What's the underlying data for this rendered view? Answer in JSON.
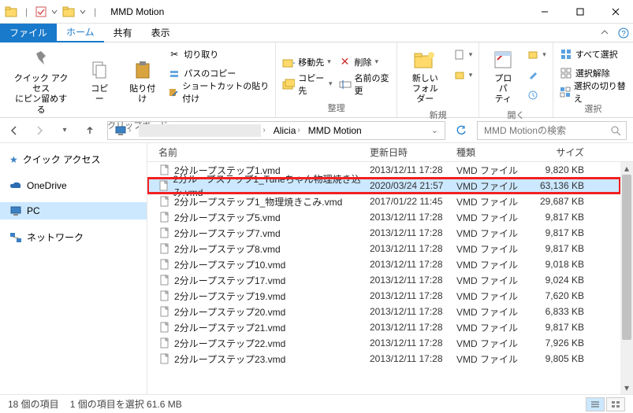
{
  "window": {
    "title": "MMD Motion"
  },
  "tabs": {
    "file": "ファイル",
    "home": "ホーム",
    "share": "共有",
    "view": "表示"
  },
  "ribbon": {
    "clipboard": {
      "label": "クリップボード",
      "quick_access": "クイック アクセス\nにピン留めする",
      "copy": "コピー",
      "paste": "貼り付け",
      "cut": "切り取り",
      "copy_path": "パスのコピー",
      "paste_shortcut": "ショートカットの貼り付け"
    },
    "organize": {
      "label": "整理",
      "move_to": "移動先",
      "copy_to": "コピー先",
      "delete": "削除",
      "rename": "名前の変更"
    },
    "new": {
      "label": "新規",
      "new_folder": "新しい\nフォルダー"
    },
    "open": {
      "label": "開く",
      "properties": "プロパ\nティ"
    },
    "select": {
      "label": "選択",
      "select_all": "すべて選択",
      "deselect": "選択解除",
      "invert": "選択の切り替え"
    }
  },
  "breadcrumb": {
    "c1": "Alicia",
    "c2": "MMD Motion"
  },
  "search": {
    "placeholder": "MMD Motionの検索"
  },
  "sidebar": {
    "quick_access": "クイック アクセス",
    "onedrive": "OneDrive",
    "pc": "PC",
    "network": "ネットワーク"
  },
  "headers": {
    "name": "名前",
    "date": "更新日時",
    "type": "種類",
    "size": "サイズ"
  },
  "files": [
    {
      "name": "2分ループステップ1.vmd",
      "date": "2013/12/11 17:28",
      "type": "VMD ファイル",
      "size": "9,820 KB",
      "selected": false,
      "highlighted": false
    },
    {
      "name": "2分ループステップ1_Tuneちゃん物理焼き込み.vmd",
      "date": "2020/03/24 21:57",
      "type": "VMD ファイル",
      "size": "63,136 KB",
      "selected": true,
      "highlighted": true
    },
    {
      "name": "2分ループステップ1_物理焼きこみ.vmd",
      "date": "2017/01/22 11:45",
      "type": "VMD ファイル",
      "size": "29,687 KB",
      "selected": false,
      "highlighted": false
    },
    {
      "name": "2分ループステップ5.vmd",
      "date": "2013/12/11 17:28",
      "type": "VMD ファイル",
      "size": "9,817 KB",
      "selected": false,
      "highlighted": false
    },
    {
      "name": "2分ループステップ7.vmd",
      "date": "2013/12/11 17:28",
      "type": "VMD ファイル",
      "size": "9,817 KB",
      "selected": false,
      "highlighted": false
    },
    {
      "name": "2分ループステップ8.vmd",
      "date": "2013/12/11 17:28",
      "type": "VMD ファイル",
      "size": "9,817 KB",
      "selected": false,
      "highlighted": false
    },
    {
      "name": "2分ループステップ10.vmd",
      "date": "2013/12/11 17:28",
      "type": "VMD ファイル",
      "size": "9,018 KB",
      "selected": false,
      "highlighted": false
    },
    {
      "name": "2分ループステップ17.vmd",
      "date": "2013/12/11 17:28",
      "type": "VMD ファイル",
      "size": "9,024 KB",
      "selected": false,
      "highlighted": false
    },
    {
      "name": "2分ループステップ19.vmd",
      "date": "2013/12/11 17:28",
      "type": "VMD ファイル",
      "size": "7,620 KB",
      "selected": false,
      "highlighted": false
    },
    {
      "name": "2分ループステップ20.vmd",
      "date": "2013/12/11 17:28",
      "type": "VMD ファイル",
      "size": "6,833 KB",
      "selected": false,
      "highlighted": false
    },
    {
      "name": "2分ループステップ21.vmd",
      "date": "2013/12/11 17:28",
      "type": "VMD ファイル",
      "size": "9,817 KB",
      "selected": false,
      "highlighted": false
    },
    {
      "name": "2分ループステップ22.vmd",
      "date": "2013/12/11 17:28",
      "type": "VMD ファイル",
      "size": "7,926 KB",
      "selected": false,
      "highlighted": false
    },
    {
      "name": "2分ループステップ23.vmd",
      "date": "2013/12/11 17:28",
      "type": "VMD ファイル",
      "size": "9,805 KB",
      "selected": false,
      "highlighted": false
    }
  ],
  "status": {
    "items": "18 個の項目",
    "selection": "1 個の項目を選択 61.6 MB"
  }
}
